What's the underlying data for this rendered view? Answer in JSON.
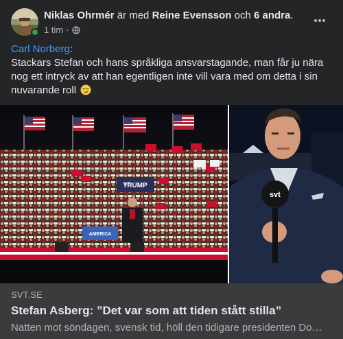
{
  "post": {
    "author": "Niklas Ohrmér",
    "with_text": "är med",
    "tagged": "Reine Evensson",
    "and_text": "och",
    "others": "6 andra",
    "suffix": ".",
    "time": "1 tim",
    "dot": "·",
    "privacy_icon": "globe-icon",
    "more_icon": "more-horizontal-icon"
  },
  "body": {
    "mention": "Carl Norberg",
    "colon": ":",
    "text": "Stackars Stefan och hans språkliga ansvarstagande, man får ju nära nog ett intryck av att han egentligen inte vill vara med om detta i sin nuvarande  roll",
    "emoji": "smirk-emoji"
  },
  "media": {
    "left_sign_text": "TRUMP",
    "left_sign_sub": "WE",
    "podium_text": "AMERICA",
    "mic_text": "svt"
  },
  "link": {
    "domain": "SVT.SE",
    "title": "Stefan Asberg: ”Det var som att tiden stått stilla”",
    "description": "Natten mot söndagen, svensk tid, höll den tidigare presidenten Do…"
  },
  "colors": {
    "background": "#242526",
    "link_box": "#3a3b3c",
    "mention": "#4599ff",
    "online": "#31a24c",
    "secondary_text": "#b0b3b8"
  }
}
